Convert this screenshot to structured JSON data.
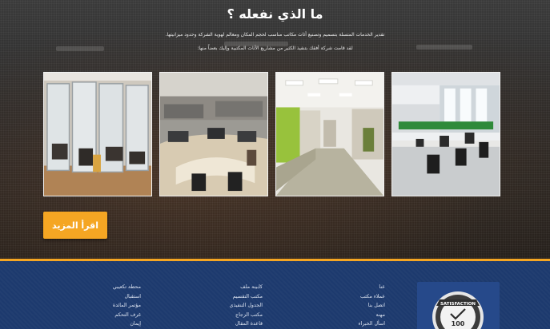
{
  "hero": {
    "title": "ما الذي نفعله ؟",
    "description_line1": "تقدير الخدمات المتسلة بتسميم وتصنيع أثاث مكاتب مناسب لحجم المكان ومعالم لهوية الشركة وحدود ميزانيتها.",
    "description_line2": "لقد قامت شركة أفقك بتنفيذ الكثير من مشاريع الأثاث المكتبية وإليك بعضاً منها:",
    "read_more_label": "اقرأ المزيد"
  },
  "gallery": [
    {
      "icon": "glass-partition-office-photo"
    },
    {
      "icon": "open-plan-workstations-photo"
    },
    {
      "icon": "office-corridor-photo"
    },
    {
      "icon": "bright-office-desks-photo"
    }
  ],
  "footer": {
    "col_right": [
      "عنا",
      "عملاء مكتب",
      "اتصل بنا",
      "مهنة",
      "اسأل الخبراء"
    ],
    "col_middle": [
      "كابينة ملف",
      "مكتب التقسيم",
      "الجدول التنفيذي",
      "مكتب الزجاج",
      "قاعدة المقال"
    ],
    "col_left": [
      "محطة تكعيبي",
      "استقبال",
      "مؤتمر المائدة",
      "غرف التحكم",
      "إيمان"
    ],
    "badge": {
      "top_text": "SATISFACTION",
      "number": "100"
    }
  },
  "colors": {
    "accent": "#f5a623",
    "footer_bg": "#1d3a6e",
    "badge_bg": "#26498a"
  }
}
